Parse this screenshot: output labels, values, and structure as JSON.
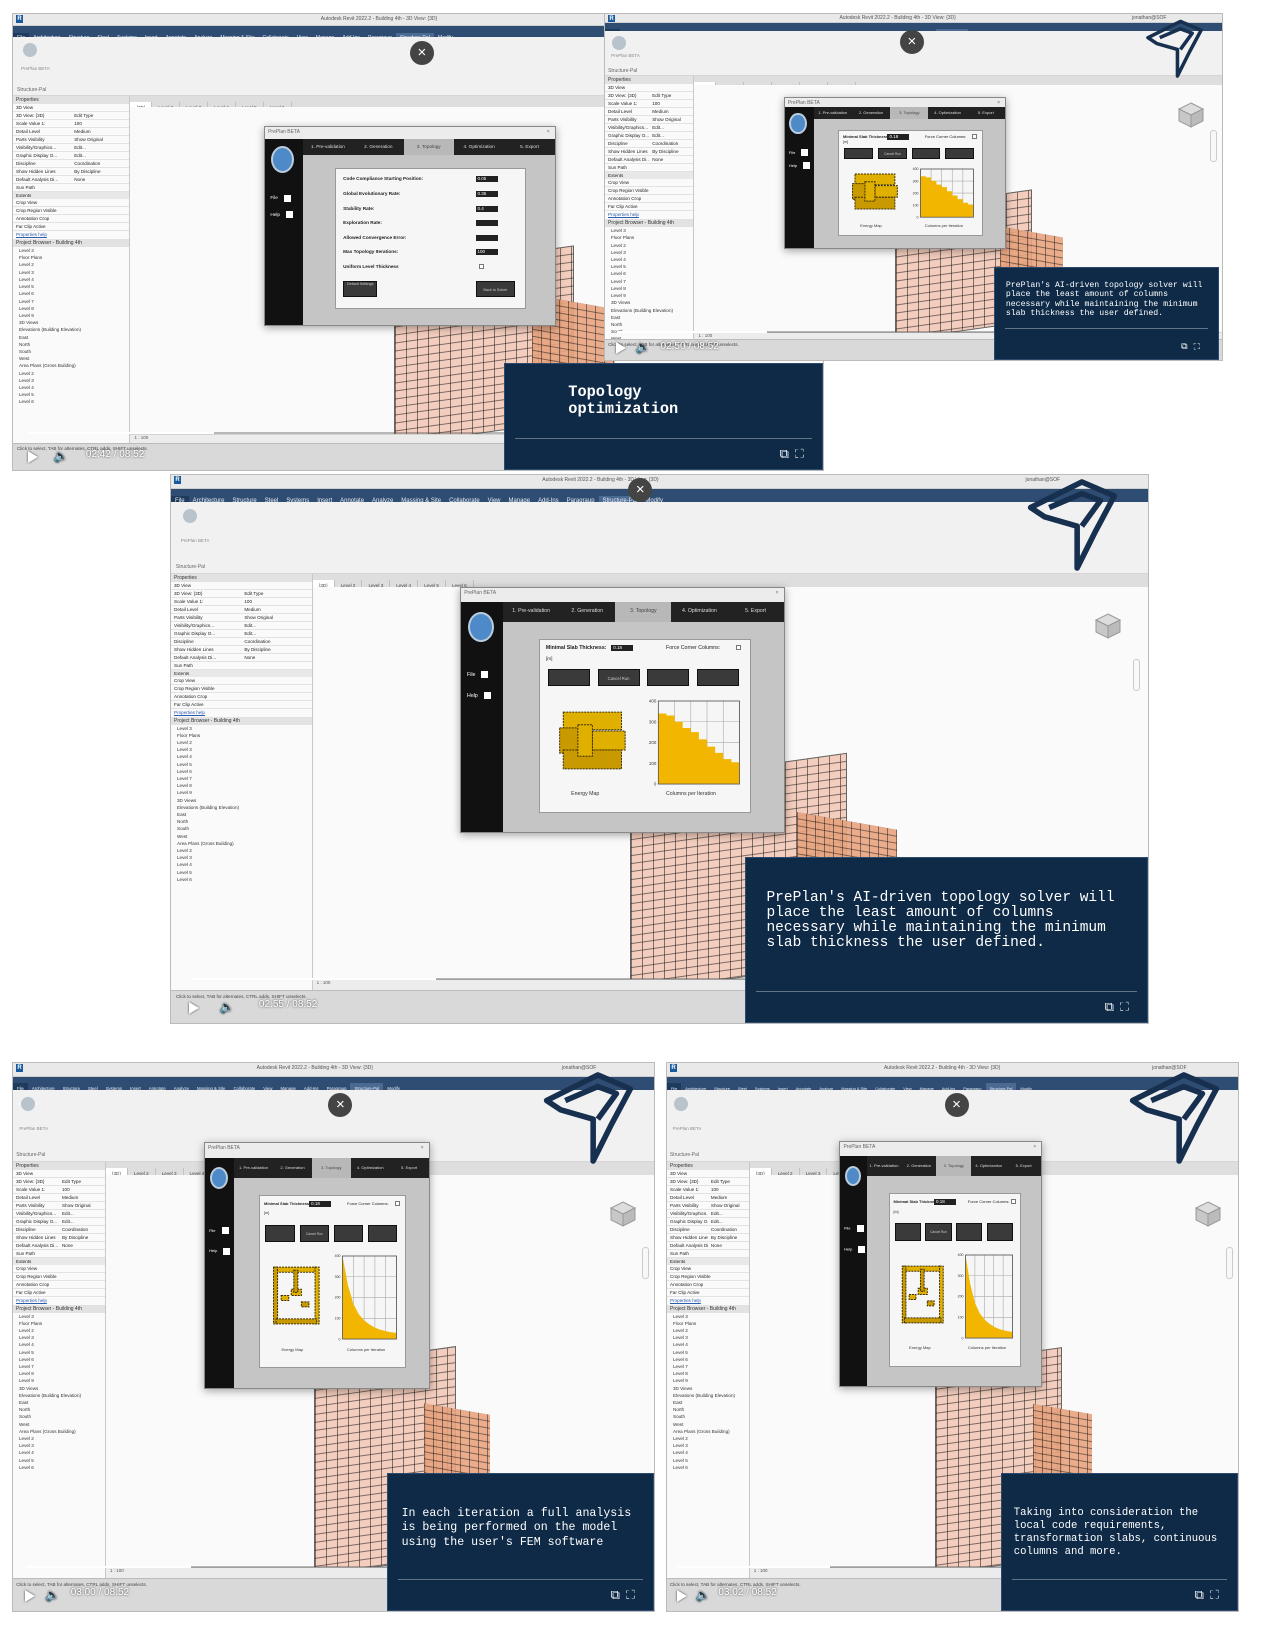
{
  "ribbon_tabs": [
    "File",
    "Architecture",
    "Structure",
    "Steel",
    "Systems",
    "Insert",
    "Annotate",
    "Analyze",
    "Massing & Site",
    "Collaborate",
    "View",
    "Manage",
    "Add-Ins",
    "Paragraup",
    "Structure-Pal",
    "Modify"
  ],
  "window_title": "Autodesk Revit 2022.2 - Building 4th - 3D View: {3D}",
  "user": "jonathan@SOF",
  "preplan_label": "PrePlan BETA",
  "panel_label": "Structure-Pal",
  "properties": {
    "title": "Properties",
    "type": "3D View",
    "selector": "3D View: {3D}",
    "edit_type": "Edit Type",
    "rows": [
      [
        "Scale Value 1:",
        "100"
      ],
      [
        "Detail Level",
        "Medium"
      ],
      [
        "Parts Visibility",
        "Show Original"
      ],
      [
        "Visibility/Graphics...",
        "Edit..."
      ],
      [
        "Graphic Display O...",
        "Edit..."
      ],
      [
        "Discipline",
        "Coordination"
      ],
      [
        "Show Hidden Lines",
        "By Discipline"
      ],
      [
        "Default Analysis Di...",
        "None"
      ],
      [
        "Sun Path",
        ""
      ]
    ],
    "extents": "Extents",
    "extent_rows": [
      "Crop View",
      "Crop Region Visible",
      "Annotation Crop",
      "Far Clip Active"
    ],
    "help": "Properties help",
    "apply": "Apply"
  },
  "browser": {
    "title": "Project Browser - Building 4th",
    "items": [
      "Level 3",
      "Floor Plans",
      "Level 2",
      "Level 3",
      "Level 4",
      "Level 5",
      "Level 6",
      "Level 7",
      "Level 8",
      "Level 9",
      "3D Views",
      "Elevations (Building Elevation)",
      "East",
      "North",
      "South",
      "West",
      "Area Plans (Gross Building)",
      "Level 2",
      "Level 3",
      "Level 4",
      "Level 5",
      "Level 6"
    ]
  },
  "view_tabs": [
    "{3D}",
    "Level 2",
    "Level 3",
    "Level 4",
    "Level 5",
    "Level 6"
  ],
  "scale": "1 : 100",
  "status_text": "Click to select, TAB for alternates, CTRL adds, SHIFT unselects.",
  "close_glyph": "×",
  "dialog": {
    "title": "PrePlan BETA",
    "tabs": [
      "1. Pre-validation",
      "2. Generation",
      "3. Topology",
      "4. Optimization",
      "5. Export"
    ],
    "menu": [
      "File",
      "Help"
    ],
    "params": [
      [
        "Code Compliance Starting Position:",
        "0.05"
      ],
      [
        "Global Evolutionary Rate:",
        "0.35"
      ],
      [
        "Stability Rate:",
        "0.4"
      ],
      [
        "Exploration Rate:",
        ""
      ],
      [
        "Allowed Convergence Error:",
        ""
      ],
      [
        "Max Topology Iterations:",
        "100"
      ],
      [
        "Uniform Level Thickness",
        ""
      ]
    ],
    "default_btn": "Default Settings",
    "back_btn": "Back to Solver",
    "slab_label": "Minimal Slab Thickness:",
    "slab_unit": "[m]",
    "slab_value": "0.18",
    "force_label": "Force Corner Columns:",
    "run_btns": [
      "Start Run",
      "Cancel Run",
      "Pause Run",
      "Continue Run"
    ],
    "energy_label": "Energy Map",
    "columns_label": "Columns per Iteration"
  },
  "chart_data": {
    "type": "area",
    "title": "",
    "xlabel": "Columns per Iteration",
    "ylabel": "",
    "yticks": [
      0,
      100,
      200,
      300,
      400
    ],
    "ylim": [
      0,
      400
    ],
    "x": [
      0,
      1,
      2,
      3,
      4,
      5,
      6,
      7,
      8,
      9,
      10
    ],
    "series": [
      {
        "values": [
          340,
          330,
          300,
          270,
          250,
          215,
          180,
          150,
          120,
          105,
          70
        ]
      },
      {
        "values": [
          400,
          260,
          170,
          120,
          90,
          70,
          55,
          45,
          38,
          33,
          30
        ]
      }
    ],
    "color": "#f2b600"
  },
  "frames": [
    {
      "time": "02:42 / 08:52",
      "caption": "Topology\noptimization",
      "progress": 0.3
    },
    {
      "time": "02:50 / 08:52",
      "caption": "PrePlan's AI-driven topology solver will place the least amount of columns necessary while maintaining the minimum slab thickness the user defined.",
      "progress": 0.32
    },
    {
      "time": "02:55 / 08:52",
      "caption": "PrePlan's AI-driven topology solver will place the least amount of columns necessary while maintaining the minimum slab thickness the user defined.",
      "progress": 0.33
    },
    {
      "time": "03:00 / 08:52",
      "caption": "In each iteration a full analysis is being performed on the model using the user's FEM software",
      "progress": 0.34
    },
    {
      "time": "03:02 / 08:52",
      "caption": "Taking into consideration the local code requirements, transformation slabs, continuous columns and more.",
      "progress": 0.35
    }
  ],
  "colors": {
    "ribbon": "#2f4d72",
    "caption_bg": "#0e2a47",
    "accent": "#f2b600"
  }
}
